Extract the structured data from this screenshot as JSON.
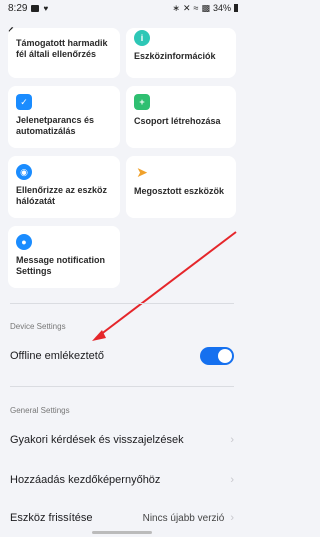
{
  "status_bar": {
    "time": "8:29",
    "right_text": "34%"
  },
  "cards": [
    {
      "label": "Támogatott harmadik fél általi ellenőrzés",
      "icon": "third-party-icon",
      "color": "#1570ef"
    },
    {
      "label": "Eszközinformációk",
      "icon": "info-icon",
      "color": "#2dc7b6"
    },
    {
      "label": "Jelenetparancs és automatizálás",
      "icon": "check-icon",
      "color": "#1a8cff"
    },
    {
      "label": "Csoport létrehozása",
      "icon": "add-group-icon",
      "color": "#2fbf71"
    },
    {
      "label": "Ellenőrizze az eszköz hálózatát",
      "icon": "wifi-icon",
      "color": "#1a8cff"
    },
    {
      "label": "Megosztott eszközök",
      "icon": "share-icon",
      "color": "#f0a12b"
    },
    {
      "label": "Message notification Settings",
      "icon": "bell-icon",
      "color": "#1a8cff"
    }
  ],
  "device_settings": {
    "header": "Device Settings",
    "offline_label": "Offline emlékeztető",
    "offline_enabled": true
  },
  "general_settings": {
    "header": "General Settings",
    "faq_label": "Gyakori kérdések és visszajelzések",
    "home_label": "Hozzáadás kezdőképernyőhöz",
    "update_label": "Eszköz frissítése",
    "update_value": "Nincs újabb verzió"
  }
}
